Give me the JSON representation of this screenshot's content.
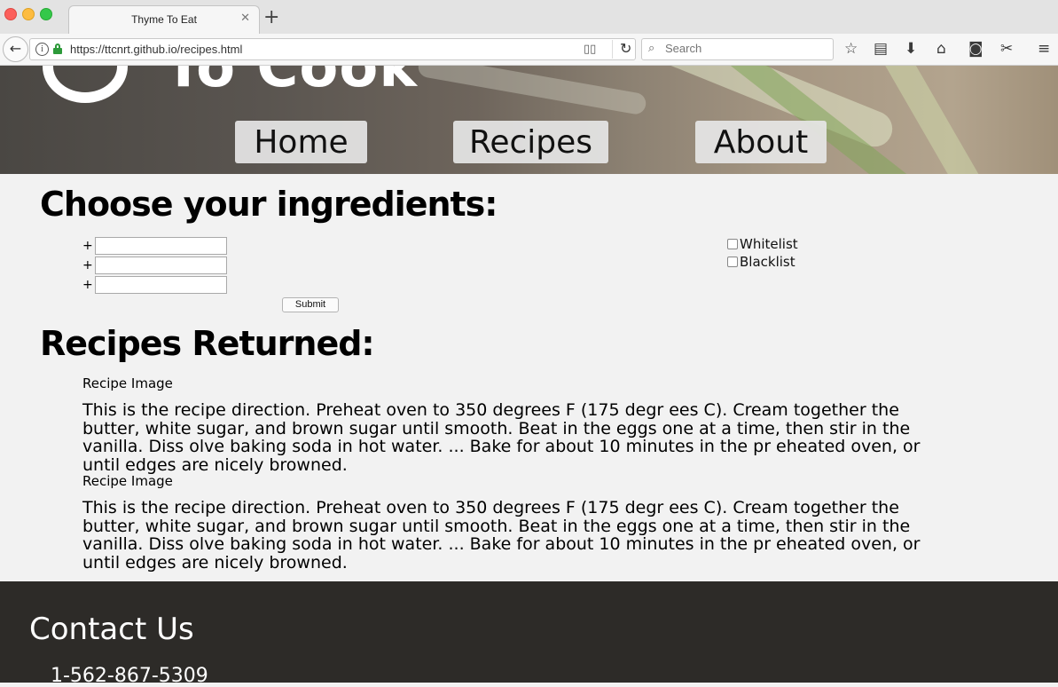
{
  "browser": {
    "tab_title": "Thyme To Eat",
    "tab_close": "✕",
    "new_tab": "+",
    "url": "https://ttcnrt.github.io/recipes.html",
    "search_placeholder": "Search",
    "icons": [
      "back-icon",
      "info-icon",
      "lock-icon",
      "reader-view-icon",
      "reload-icon",
      "search-icon",
      "bookmark-star-icon",
      "reading-list-icon",
      "download-icon",
      "home-icon",
      "pocket-icon",
      "extension-icon",
      "menu-icon"
    ]
  },
  "header": {
    "logo_text": "To Cook",
    "nav": [
      {
        "label": "Home"
      },
      {
        "label": "Recipes"
      },
      {
        "label": "About"
      }
    ]
  },
  "ingredients": {
    "title": "Choose your ingredients:",
    "plus": "+",
    "fields": [
      {
        "value": ""
      },
      {
        "value": ""
      },
      {
        "value": ""
      }
    ],
    "submit_label": "Submit",
    "filters": [
      {
        "label": "Whitelist",
        "checked": false
      },
      {
        "label": "Blacklist",
        "checked": false
      }
    ]
  },
  "results": {
    "title": "Recipes Returned:",
    "recipes": [
      {
        "image_label": "Recipe Image",
        "direction": "This is the recipe direction. Preheat oven to 350 degrees F (175 degr ees C). Cream together the butter, white sugar, and brown sugar until smooth. Beat in the eggs one at a time, then stir in the vanilla. Diss olve baking soda in hot water. ... Bake for about 10 minutes in the pr eheated oven, or until edges are nicely browned."
      },
      {
        "image_label": "Recipe Image",
        "direction": "This is the recipe direction. Preheat oven to 350 degrees F (175 degr ees C). Cream together the butter, white sugar, and brown sugar until smooth. Beat in the eggs one at a time, then stir in the vanilla. Diss olve baking soda in hot water. ... Bake for about 10 minutes in the pr eheated oven, or until edges are nicely browned."
      }
    ]
  },
  "footer": {
    "title": "Contact Us",
    "phone": "1-562-867-5309"
  }
}
